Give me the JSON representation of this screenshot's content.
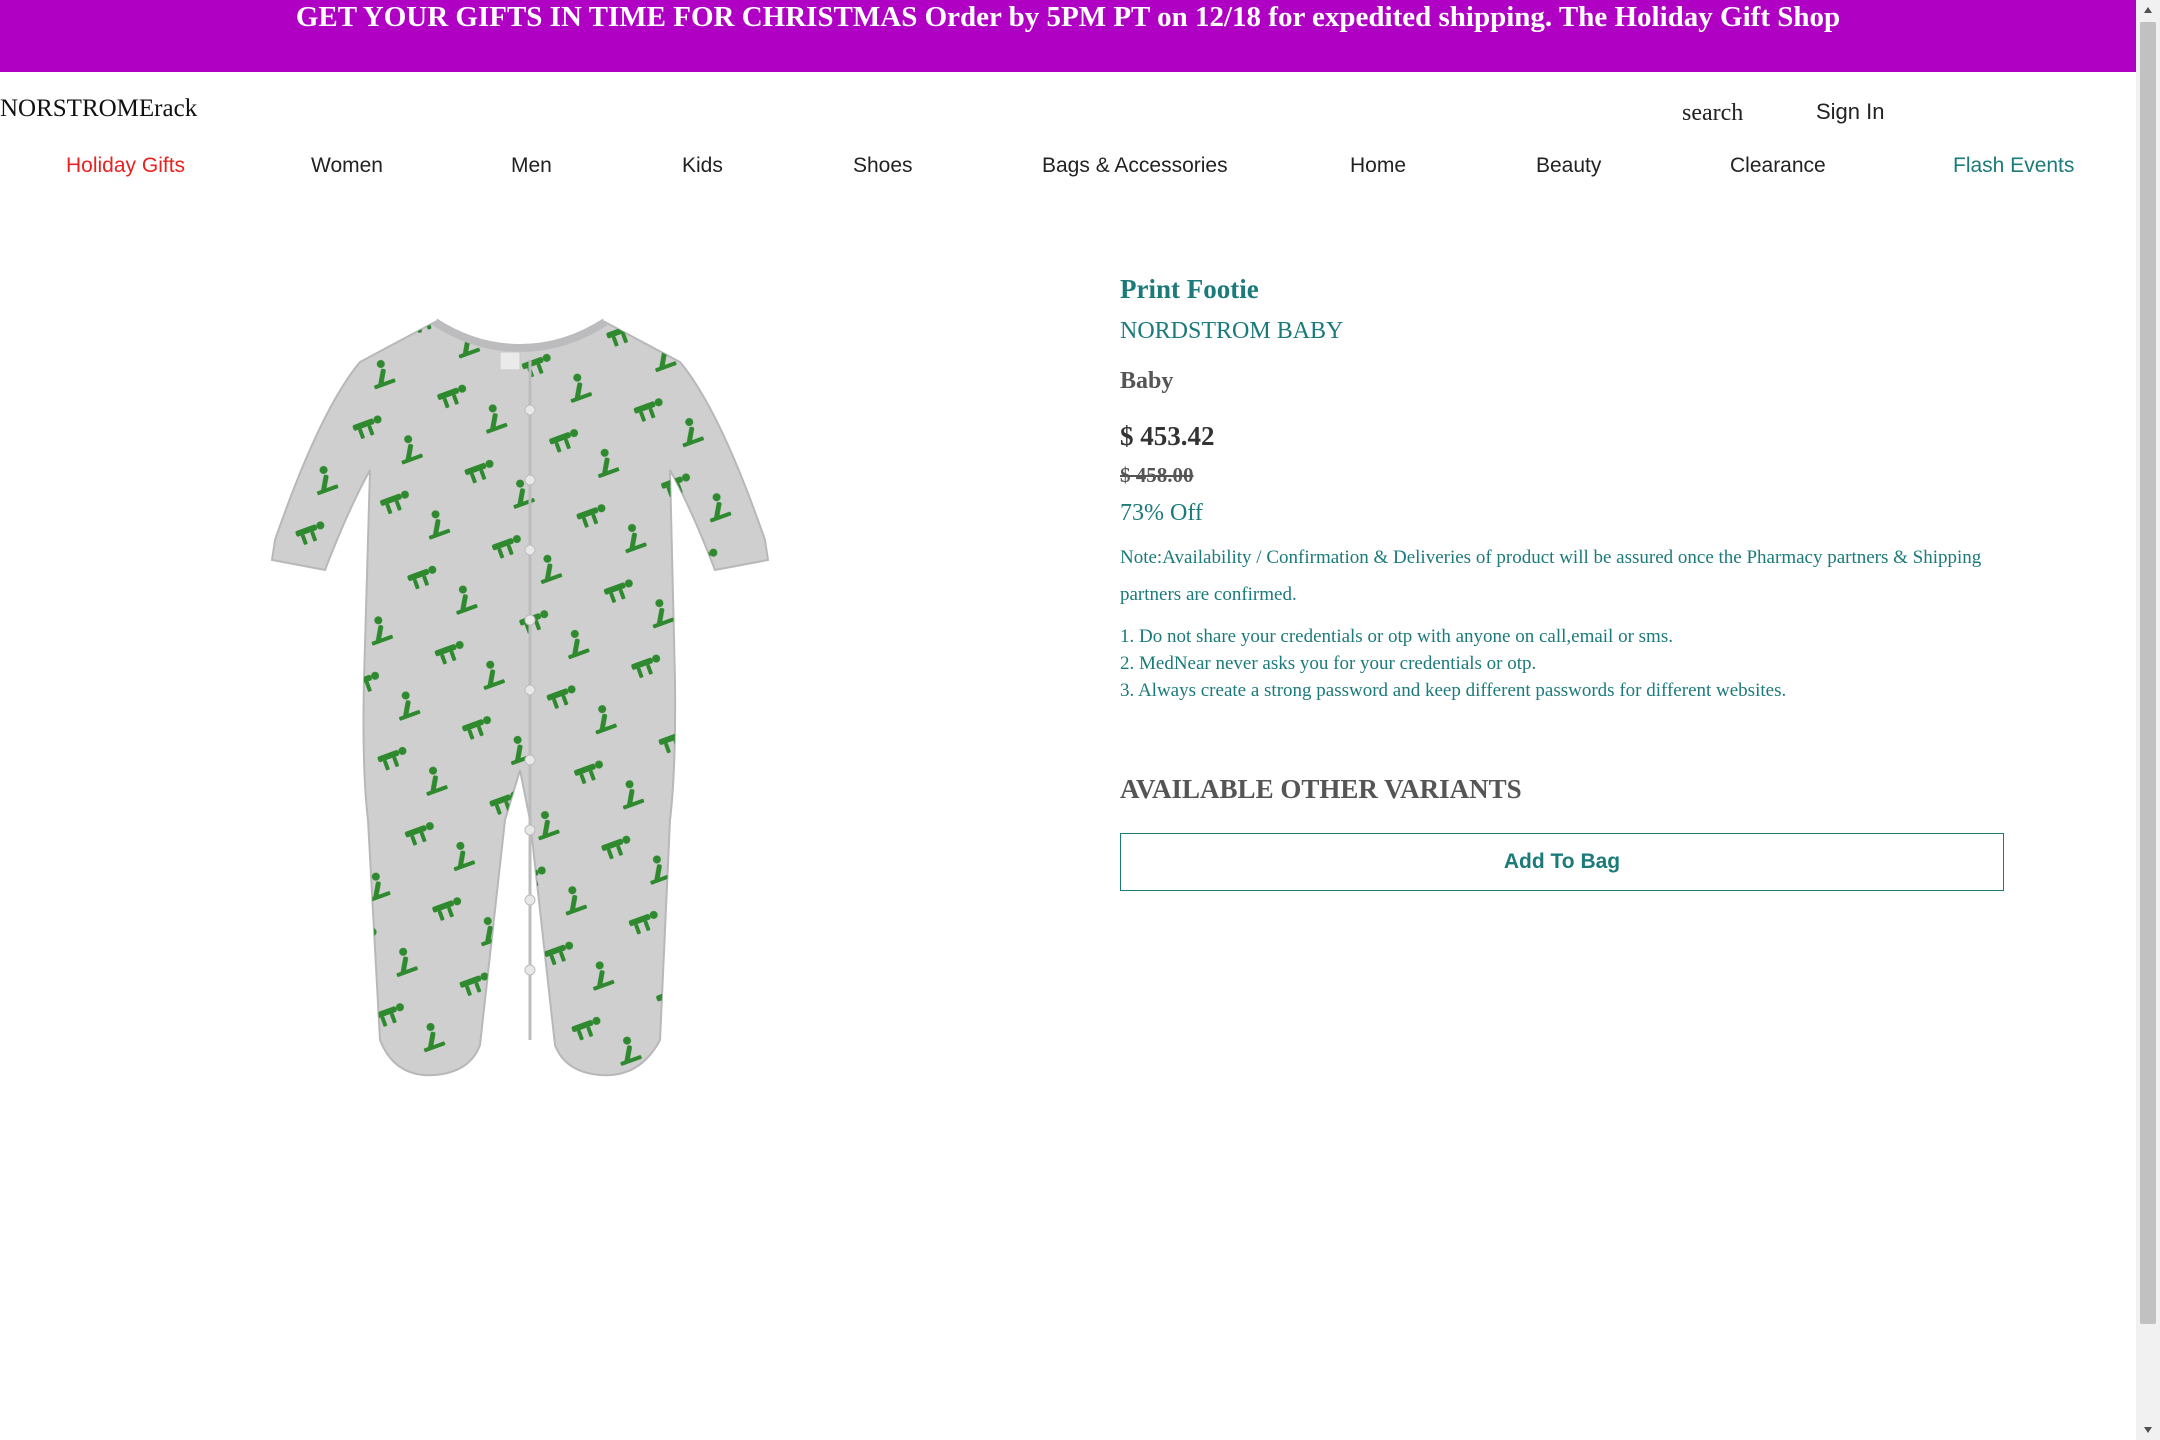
{
  "banner": {
    "text": "GET YOUR GIFTS IN TIME FOR CHRISTMAS Order by 5PM PT on 12/18 for expedited shipping. The Holiday Gift Shop"
  },
  "header": {
    "logo": "NORSTROMErack",
    "search_label": "search",
    "signin_label": "Sign In"
  },
  "nav": {
    "items": [
      {
        "label": "Holiday Gifts",
        "color": "#e8231f"
      },
      {
        "label": "Women"
      },
      {
        "label": "Men"
      },
      {
        "label": "Kids"
      },
      {
        "label": "Shoes"
      },
      {
        "label": "Bags & Accessories"
      },
      {
        "label": "Home"
      },
      {
        "label": "Beauty"
      },
      {
        "label": "Clearance"
      },
      {
        "label": "Flash Events",
        "color": "#1b7a7a"
      }
    ]
  },
  "product": {
    "title": "Print Footie",
    "brand": "NORDSTROM BABY",
    "category": "Baby",
    "price": "$ 453.42",
    "original_price": "$ 458.00",
    "discount": "73% Off",
    "note": "Note:Availability / Confirmation & Deliveries of product will be assured once the Pharmacy partners & Shipping partners are confirmed.",
    "tips": [
      "1. Do not share your credentials or otp with anyone on call,email or sms.",
      "2. MedNear never asks you for your credentials or otp.",
      "3. Always create a strong password and keep different passwords for different websites."
    ],
    "variants_heading": "AVAILABLE OTHER VARIANTS",
    "add_to_bag_label": "Add To Bag",
    "image_icon": "footie-pajama-image"
  },
  "colors": {
    "banner_bg": "#b000c4",
    "accent_teal": "#1b7a7a",
    "holiday_red": "#e8231f"
  }
}
